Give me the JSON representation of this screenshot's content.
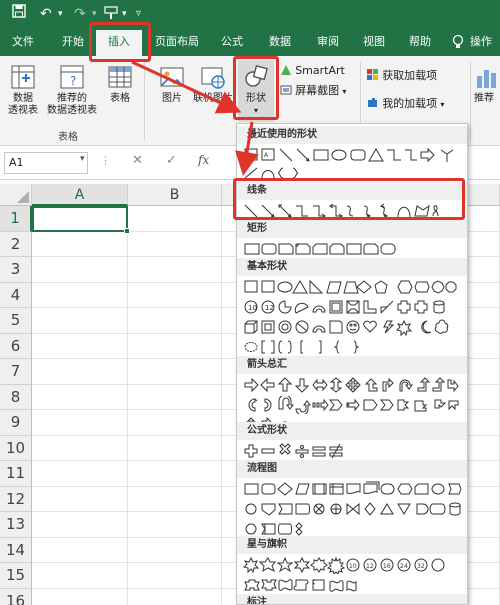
{
  "ribbon_tabs": [
    "文件",
    "开始",
    "插入",
    "页面布局",
    "公式",
    "数据",
    "审阅",
    "视图",
    "帮助",
    "操作"
  ],
  "ribbon": {
    "pivot_table": "数据\n透视表",
    "recommended_pivot": "推荐的\n数据透视表",
    "table": "表格",
    "tables_group": "表格",
    "picture": "图片",
    "online_picture": "联机图片",
    "shapes": "形状",
    "smartart": "SmartArt",
    "screenshot": "屏幕截图",
    "get_addins": "获取加载项",
    "my_addins": "我的加载项",
    "recommended_right": "推荐"
  },
  "formula_bar": {
    "name_box": "A1",
    "fx": "fx"
  },
  "grid": {
    "columns": [
      "A",
      "B"
    ],
    "rows": [
      "1",
      "2",
      "3",
      "4",
      "5",
      "6",
      "7",
      "8",
      "9",
      "10",
      "11",
      "12",
      "13",
      "14",
      "15",
      "16"
    ]
  },
  "dropdown": {
    "sections": [
      "最近使用的形状",
      "线条",
      "矩形",
      "基本形状",
      "箭头总汇",
      "公式形状",
      "流程图",
      "星与旗帜",
      "标注"
    ]
  },
  "colors": {
    "excel_green": "#217346",
    "highlight_red": "#e0332a"
  }
}
